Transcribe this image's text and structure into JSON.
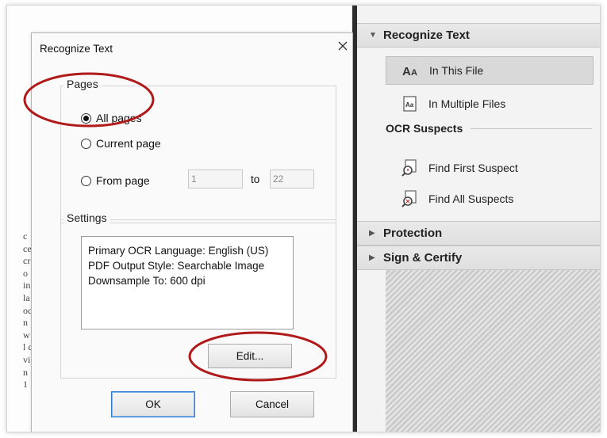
{
  "dialog": {
    "title": "Recognize Text",
    "close_icon": "close-icon",
    "pages": {
      "label": "Pages",
      "options": [
        {
          "label": "All pages",
          "selected": true
        },
        {
          "label": "Current page",
          "selected": false
        },
        {
          "label": "From page",
          "selected": false
        }
      ],
      "from_value": "1",
      "to_label": "to",
      "to_value": "22"
    },
    "settings": {
      "label": "Settings",
      "lines": [
        "Primary OCR Language: English (US)",
        "PDF Output Style: Searchable Image",
        "Downsample To: 600 dpi"
      ],
      "edit_label": "Edit..."
    },
    "buttons": {
      "ok": "OK",
      "cancel": "Cancel"
    }
  },
  "panel": {
    "sections": {
      "recognize_text": {
        "title": "Recognize Text",
        "expanded": true,
        "items": [
          {
            "label": "In This File",
            "icon": "text-aa-icon",
            "selected": true
          },
          {
            "label": "In Multiple Files",
            "icon": "document-text-icon",
            "selected": false
          }
        ]
      },
      "ocr_suspects": {
        "title": "OCR Suspects",
        "items": [
          {
            "label": "Find First Suspect",
            "icon": "find-first-suspect-icon"
          },
          {
            "label": "Find All Suspects",
            "icon": "find-all-suspects-icon"
          }
        ]
      },
      "protection": {
        "title": "Protection",
        "expanded": false
      },
      "sign_certify": {
        "title": "Sign & Certify",
        "expanded": false
      }
    }
  },
  "background_text": [
    "c",
    "ce",
    "cr",
    "o",
    "in",
    "la",
    "oc",
    "n",
    "w",
    "l c",
    "vi",
    "n",
    "1"
  ],
  "colors": {
    "annotation_red": "#b01a1a",
    "ok_border": "#2f7bd1",
    "panel_bg": "#f3f3f3",
    "selected_item_bg": "#d9d9d9"
  }
}
